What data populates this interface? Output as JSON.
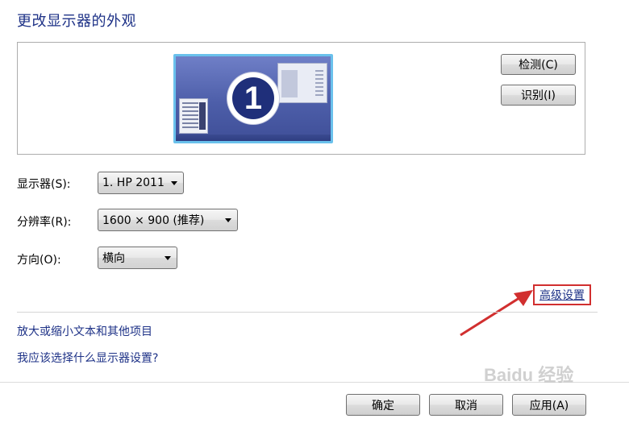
{
  "page": {
    "title": "更改显示器的外观"
  },
  "preview": {
    "monitor_number": "1",
    "detect_label": "检测(C)",
    "identify_label": "识别(I)"
  },
  "settings": {
    "display_label": "显示器(S):",
    "display_value": "1. HP 2011",
    "resolution_label": "分辨率(R):",
    "resolution_value": "1600 × 900 (推荐)",
    "orientation_label": "方向(O):",
    "orientation_value": "横向"
  },
  "advanced_link": "高级设置",
  "links": {
    "text_size": "放大或缩小文本和其他项目",
    "which_settings": "我应该选择什么显示器设置?"
  },
  "footer": {
    "ok_label": "确定",
    "cancel_label": "取消",
    "apply_label": "应用(A)"
  },
  "watermark": "Baidu 经验",
  "colors": {
    "title": "#1e3287",
    "link": "#1e3287",
    "highlight_box": "#d12f2f",
    "arrow": "#d12f2f"
  }
}
